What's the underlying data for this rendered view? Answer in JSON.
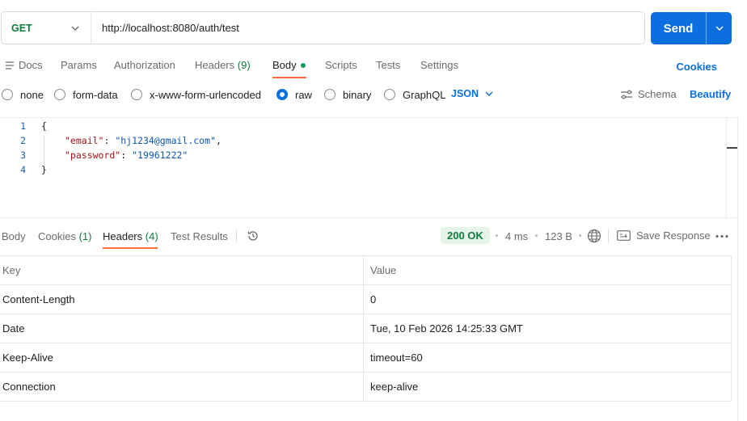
{
  "request": {
    "method": "GET",
    "url": "http://localhost:8080/auth/test",
    "send_label": "Send"
  },
  "request_tabs": {
    "docs": "Docs",
    "params": "Params",
    "authorization": "Authorization",
    "headers": "Headers",
    "headers_count": "(9)",
    "body": "Body",
    "scripts": "Scripts",
    "tests": "Tests",
    "settings": "Settings",
    "cookies": "Cookies"
  },
  "body_types": {
    "none": "none",
    "form_data": "form-data",
    "urlencoded": "x-www-form-urlencoded",
    "raw": "raw",
    "binary": "binary",
    "graphql": "GraphQL",
    "selected": "raw",
    "format": "JSON",
    "schema": "Schema",
    "beautify": "Beautify"
  },
  "editor": {
    "line_numbers": [
      "1",
      "2",
      "3",
      "4"
    ],
    "open_brace": "{",
    "close_brace": "}",
    "fields": [
      {
        "key": "\"email\"",
        "value": "\"hj1234@gmail.com\"",
        "trail": ","
      },
      {
        "key": "\"password\"",
        "value": "\"19961222\"",
        "trail": ""
      }
    ]
  },
  "response_tabs": {
    "body": "Body",
    "cookies": "Cookies",
    "cookies_count": "(1)",
    "headers": "Headers",
    "headers_count": "(4)",
    "test_results": "Test Results"
  },
  "response_meta": {
    "status": "200 OK",
    "time": "4 ms",
    "size": "123 B",
    "save": "Save Response"
  },
  "headers_table": {
    "columns": [
      "Key",
      "Value"
    ],
    "rows": [
      {
        "key": "Content-Length",
        "value": "0"
      },
      {
        "key": "Date",
        "value": "Tue, 10 Feb 2026 14:25:33 GMT"
      },
      {
        "key": "Keep-Alive",
        "value": "timeout=60"
      },
      {
        "key": "Connection",
        "value": "keep-alive"
      }
    ]
  },
  "colors": {
    "accent": "#0b6fe0",
    "method_get": "#0f7b3f",
    "tab_indicator": "#ff6c37",
    "status_bg": "#e6f4ea"
  },
  "icons": [
    "chevron-down-icon",
    "docs-icon",
    "schema-icon",
    "history-icon",
    "globe-icon",
    "save-response-icon",
    "more-options-icon"
  ]
}
